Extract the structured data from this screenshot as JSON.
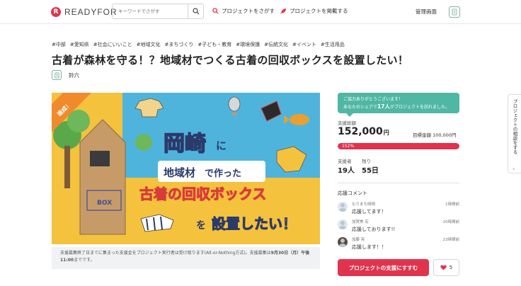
{
  "header": {
    "logo_mark": "R",
    "logo_text": "READYFOR",
    "search_placeholder": "キーワードでさがす",
    "nav": [
      {
        "label": "プロジェクトをさがす",
        "icon": "search-circle-icon"
      },
      {
        "label": "プロジェクトを掲載する",
        "icon": "rocket-icon"
      }
    ],
    "admin_label": "管理画面"
  },
  "tags": [
    "#中部",
    "#愛知県",
    "#社会にいいこと",
    "#地域文化",
    "#まちづくり",
    "#子ども・教育",
    "#環境保護",
    "#伝統文化",
    "#イベント",
    "#生活用品"
  ],
  "project": {
    "title": "古着が森林を守る！？地域材でつくる古着の回収ボックスを設置したい！",
    "owner": "鈴六"
  },
  "hero": {
    "badge": "達成！",
    "box_label": "BOX",
    "word1": "岡崎",
    "word2": "に",
    "word3": "地域材",
    "word4": "で作った",
    "line2": "古着の回収ボックス",
    "line3a": "を",
    "line3b": "設置したい！",
    "colors": {
      "sky": "#4fb4dc",
      "yellow": "#f4c23c",
      "red": "#d93a3a",
      "wood": "#c69b67"
    }
  },
  "notice": {
    "line1": "支援募集終了日までに集まった支援金をプロジェクト実行者は受け取ります(All-or-Nothing方式)。支援募集は",
    "deadline": "9月30日（月）午後11:00",
    "line1_end": "までです。"
  },
  "sidebar": {
    "thanks_line1": "ご協力ありがとうございます！",
    "thanks_line2_pre": "あなたのシェアで",
    "thanks_count": "17人",
    "thanks_line2_post": "がプロジェクトを訪れました。",
    "total_label": "支援総額",
    "total_amount": "152,000",
    "total_unit": "円",
    "target_label": "目標金額 100,000円",
    "progress_label": "152%",
    "progress_percent": 152,
    "supporters_label": "支援者",
    "supporters_value": "19人",
    "remaining_label": "残り",
    "remaining_value": "55日",
    "comments_header": "応援コメント",
    "comments": [
      {
        "name": "もりまち岡崎",
        "time": "1時間前",
        "text": "応援してます！"
      },
      {
        "name": "加賀美 宏",
        "time": "20時間前",
        "text": "応援しております!!"
      },
      {
        "name": "加藤 亮",
        "time": "23時間前",
        "text": "応援します！！"
      }
    ],
    "support_button": "プロジェクトの支援にすすむ",
    "like_count": "5"
  },
  "consult_tab": "プロジェクトの相談をする",
  "accent_color": "#e0334d"
}
